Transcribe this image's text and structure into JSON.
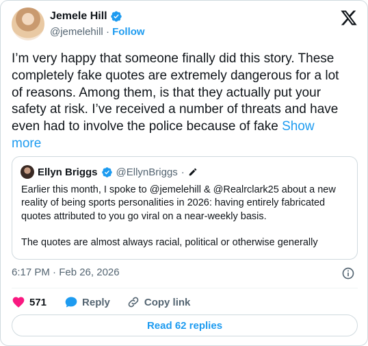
{
  "author": {
    "name": "Jemele Hill",
    "handle": "@jemelehill",
    "separator": "·",
    "follow_label": "Follow"
  },
  "tweet": {
    "text": "I’m very happy that someone finally did this story. These completely fake quotes are extremely dangerous for a lot of reasons. Among them, is that they actually put your safety at risk. I’ve received a number of threats and have even had to involve the police because of fake ",
    "show_more_label": "Show more"
  },
  "quote": {
    "name": "Ellyn Briggs",
    "handle": "@EllynBriggs",
    "separator": "·",
    "paragraph1": "Earlier this month, I spoke to @jemelehill & @Realrclark25 about a new reality of being sports personalities in 2026: having entirely fabricated quotes attributed to you go viral on a near-weekly basis.",
    "paragraph2": "The quotes are almost always racial, political or otherwise generally"
  },
  "timestamp": "6:17 PM · Feb 26, 2026",
  "actions": {
    "likes_count": "571",
    "reply_label": "Reply",
    "copy_link_label": "Copy link"
  },
  "read_replies_label": "Read 62 replies",
  "colors": {
    "accent": "#1d9bf0",
    "like": "#f91880",
    "muted": "#536471",
    "text": "#0f1419"
  },
  "icons": [
    "verified-icon",
    "x-logo-icon",
    "edit-icon",
    "info-icon",
    "heart-icon",
    "reply-icon",
    "link-icon"
  ]
}
